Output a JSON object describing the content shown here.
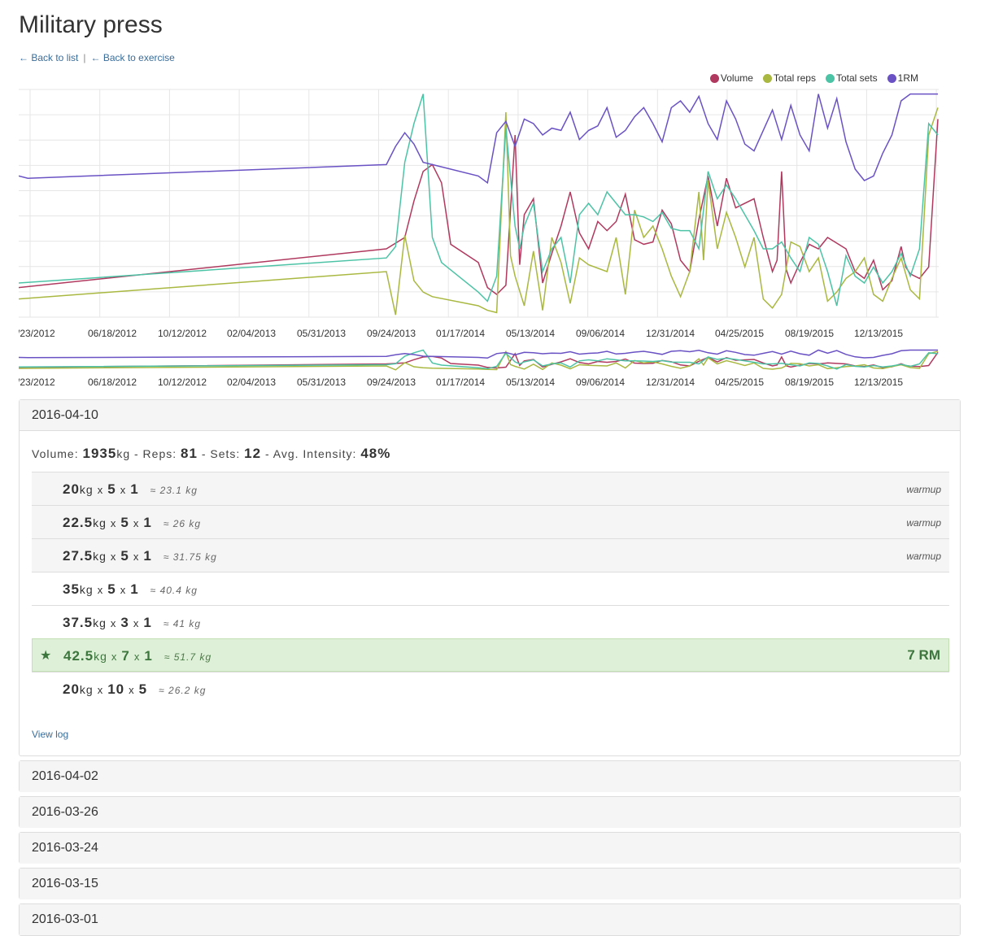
{
  "page": {
    "title": "Military press",
    "back_to_list": "← Back to list",
    "separator": "|",
    "back_to_exercise": "← Back to exercise"
  },
  "colors": {
    "volume": "#b0395f",
    "reps": "#a9b840",
    "sets": "#4dc3a6",
    "rm": "#6a52c4",
    "grid": "#e6e6e6"
  },
  "chart_data": {
    "type": "line",
    "legend_position": "top-right",
    "grid": true,
    "x_ticks": [
      "/23/2012",
      "06/18/2012",
      "10/12/2012",
      "02/04/2013",
      "05/31/2013",
      "09/24/2013",
      "01/17/2014",
      "05/13/2014",
      "09/06/2014",
      "12/31/2014",
      "04/25/2015",
      "08/19/2015",
      "12/13/2015"
    ],
    "series": [
      {
        "name": "Volume",
        "color": "#b0395f",
        "values": [
          [
            0,
            0.13
          ],
          [
            0.4,
            0.3
          ],
          [
            0.42,
            0.35
          ],
          [
            0.43,
            0.51
          ],
          [
            0.44,
            0.64
          ],
          [
            0.45,
            0.67
          ],
          [
            0.46,
            0.59
          ],
          [
            0.47,
            0.32
          ],
          [
            0.5,
            0.24
          ],
          [
            0.51,
            0.13
          ],
          [
            0.52,
            0.1
          ],
          [
            0.53,
            0.14
          ],
          [
            0.54,
            0.8
          ],
          [
            0.545,
            0.23
          ],
          [
            0.55,
            0.45
          ],
          [
            0.56,
            0.52
          ],
          [
            0.57,
            0.15
          ],
          [
            0.58,
            0.28
          ],
          [
            0.59,
            0.4
          ],
          [
            0.6,
            0.55
          ],
          [
            0.61,
            0.37
          ],
          [
            0.62,
            0.3
          ],
          [
            0.63,
            0.42
          ],
          [
            0.64,
            0.38
          ],
          [
            0.65,
            0.42
          ],
          [
            0.66,
            0.54
          ],
          [
            0.67,
            0.34
          ],
          [
            0.68,
            0.32
          ],
          [
            0.69,
            0.33
          ],
          [
            0.7,
            0.47
          ],
          [
            0.71,
            0.41
          ],
          [
            0.72,
            0.25
          ],
          [
            0.73,
            0.2
          ],
          [
            0.74,
            0.43
          ],
          [
            0.75,
            0.62
          ],
          [
            0.76,
            0.4
          ],
          [
            0.77,
            0.61
          ],
          [
            0.78,
            0.48
          ],
          [
            0.8,
            0.52
          ],
          [
            0.81,
            0.35
          ],
          [
            0.82,
            0.2
          ],
          [
            0.825,
            0.25
          ],
          [
            0.83,
            0.64
          ],
          [
            0.835,
            0.21
          ],
          [
            0.84,
            0.15
          ],
          [
            0.85,
            0.24
          ],
          [
            0.86,
            0.32
          ],
          [
            0.87,
            0.3
          ],
          [
            0.88,
            0.35
          ],
          [
            0.9,
            0.3
          ],
          [
            0.91,
            0.2
          ],
          [
            0.92,
            0.17
          ],
          [
            0.93,
            0.25
          ],
          [
            0.94,
            0.12
          ],
          [
            0.95,
            0.16
          ],
          [
            0.96,
            0.31
          ],
          [
            0.965,
            0.22
          ],
          [
            0.97,
            0.19
          ],
          [
            0.98,
            0.17
          ],
          [
            0.99,
            0.22
          ],
          [
            1,
            0.87
          ]
        ]
      },
      {
        "name": "Total reps",
        "color": "#a9b840",
        "values": [
          [
            0,
            0.08
          ],
          [
            0.4,
            0.2
          ],
          [
            0.41,
            0.01
          ],
          [
            0.42,
            0.36
          ],
          [
            0.43,
            0.16
          ],
          [
            0.44,
            0.11
          ],
          [
            0.45,
            0.09
          ],
          [
            0.5,
            0.05
          ],
          [
            0.51,
            0.03
          ],
          [
            0.52,
            0.02
          ],
          [
            0.53,
            0.9
          ],
          [
            0.535,
            0.27
          ],
          [
            0.54,
            0.18
          ],
          [
            0.55,
            0.05
          ],
          [
            0.56,
            0.29
          ],
          [
            0.57,
            0.03
          ],
          [
            0.58,
            0.35
          ],
          [
            0.59,
            0.24
          ],
          [
            0.6,
            0.06
          ],
          [
            0.61,
            0.26
          ],
          [
            0.62,
            0.23
          ],
          [
            0.64,
            0.2
          ],
          [
            0.65,
            0.35
          ],
          [
            0.66,
            0.1
          ],
          [
            0.67,
            0.47
          ],
          [
            0.68,
            0.35
          ],
          [
            0.69,
            0.4
          ],
          [
            0.7,
            0.3
          ],
          [
            0.71,
            0.18
          ],
          [
            0.72,
            0.09
          ],
          [
            0.73,
            0.2
          ],
          [
            0.74,
            0.55
          ],
          [
            0.745,
            0.25
          ],
          [
            0.75,
            0.6
          ],
          [
            0.76,
            0.3
          ],
          [
            0.77,
            0.46
          ],
          [
            0.78,
            0.35
          ],
          [
            0.79,
            0.22
          ],
          [
            0.8,
            0.35
          ],
          [
            0.81,
            0.08
          ],
          [
            0.82,
            0.04
          ],
          [
            0.83,
            0.1
          ],
          [
            0.84,
            0.33
          ],
          [
            0.85,
            0.31
          ],
          [
            0.86,
            0.2
          ],
          [
            0.87,
            0.26
          ],
          [
            0.88,
            0.07
          ],
          [
            0.89,
            0.11
          ],
          [
            0.9,
            0.17
          ],
          [
            0.91,
            0.2
          ],
          [
            0.92,
            0.26
          ],
          [
            0.93,
            0.1
          ],
          [
            0.94,
            0.07
          ],
          [
            0.95,
            0.17
          ],
          [
            0.96,
            0.26
          ],
          [
            0.97,
            0.12
          ],
          [
            0.98,
            0.08
          ],
          [
            0.99,
            0.8
          ],
          [
            1,
            0.92
          ]
        ]
      },
      {
        "name": "Total sets",
        "color": "#4dc3a6",
        "values": [
          [
            0,
            0.15
          ],
          [
            0.4,
            0.26
          ],
          [
            0.41,
            0.31
          ],
          [
            0.42,
            0.68
          ],
          [
            0.43,
            0.85
          ],
          [
            0.44,
            0.98
          ],
          [
            0.45,
            0.35
          ],
          [
            0.46,
            0.24
          ],
          [
            0.5,
            0.11
          ],
          [
            0.51,
            0.07
          ],
          [
            0.52,
            0.18
          ],
          [
            0.53,
            0.83
          ],
          [
            0.54,
            0.4
          ],
          [
            0.545,
            0.3
          ],
          [
            0.55,
            0.4
          ],
          [
            0.56,
            0.5
          ],
          [
            0.57,
            0.2
          ],
          [
            0.58,
            0.3
          ],
          [
            0.59,
            0.35
          ],
          [
            0.6,
            0.15
          ],
          [
            0.61,
            0.45
          ],
          [
            0.62,
            0.5
          ],
          [
            0.63,
            0.45
          ],
          [
            0.64,
            0.55
          ],
          [
            0.65,
            0.5
          ],
          [
            0.66,
            0.45
          ],
          [
            0.67,
            0.45
          ],
          [
            0.68,
            0.44
          ],
          [
            0.69,
            0.42
          ],
          [
            0.7,
            0.46
          ],
          [
            0.71,
            0.39
          ],
          [
            0.72,
            0.38
          ],
          [
            0.73,
            0.38
          ],
          [
            0.74,
            0.3
          ],
          [
            0.75,
            0.64
          ],
          [
            0.76,
            0.52
          ],
          [
            0.77,
            0.58
          ],
          [
            0.78,
            0.52
          ],
          [
            0.8,
            0.38
          ],
          [
            0.81,
            0.3
          ],
          [
            0.82,
            0.3
          ],
          [
            0.83,
            0.33
          ],
          [
            0.84,
            0.26
          ],
          [
            0.85,
            0.2
          ],
          [
            0.86,
            0.35
          ],
          [
            0.87,
            0.32
          ],
          [
            0.88,
            0.2
          ],
          [
            0.89,
            0.05
          ],
          [
            0.9,
            0.27
          ],
          [
            0.91,
            0.18
          ],
          [
            0.92,
            0.15
          ],
          [
            0.93,
            0.22
          ],
          [
            0.94,
            0.15
          ],
          [
            0.95,
            0.2
          ],
          [
            0.96,
            0.28
          ],
          [
            0.97,
            0.18
          ],
          [
            0.98,
            0.3
          ],
          [
            0.99,
            0.85
          ],
          [
            1,
            0.8
          ]
        ]
      },
      {
        "name": "1RM",
        "color": "#6a52c4",
        "values": [
          [
            0,
            0.62
          ],
          [
            0.01,
            0.61
          ],
          [
            0.4,
            0.67
          ],
          [
            0.41,
            0.75
          ],
          [
            0.42,
            0.81
          ],
          [
            0.43,
            0.76
          ],
          [
            0.44,
            0.68
          ],
          [
            0.45,
            0.67
          ],
          [
            0.5,
            0.62
          ],
          [
            0.51,
            0.59
          ],
          [
            0.52,
            0.81
          ],
          [
            0.53,
            0.86
          ],
          [
            0.54,
            0.75
          ],
          [
            0.55,
            0.87
          ],
          [
            0.56,
            0.85
          ],
          [
            0.57,
            0.8
          ],
          [
            0.58,
            0.83
          ],
          [
            0.59,
            0.82
          ],
          [
            0.6,
            0.9
          ],
          [
            0.61,
            0.78
          ],
          [
            0.62,
            0.82
          ],
          [
            0.63,
            0.84
          ],
          [
            0.64,
            0.92
          ],
          [
            0.65,
            0.79
          ],
          [
            0.66,
            0.82
          ],
          [
            0.67,
            0.88
          ],
          [
            0.68,
            0.92
          ],
          [
            0.69,
            0.85
          ],
          [
            0.7,
            0.77
          ],
          [
            0.71,
            0.92
          ],
          [
            0.72,
            0.95
          ],
          [
            0.73,
            0.9
          ],
          [
            0.74,
            0.97
          ],
          [
            0.75,
            0.85
          ],
          [
            0.76,
            0.78
          ],
          [
            0.77,
            0.95
          ],
          [
            0.78,
            0.87
          ],
          [
            0.79,
            0.76
          ],
          [
            0.8,
            0.73
          ],
          [
            0.81,
            0.82
          ],
          [
            0.82,
            0.91
          ],
          [
            0.83,
            0.78
          ],
          [
            0.84,
            0.93
          ],
          [
            0.85,
            0.8
          ],
          [
            0.86,
            0.73
          ],
          [
            0.87,
            0.98
          ],
          [
            0.88,
            0.83
          ],
          [
            0.89,
            0.96
          ],
          [
            0.9,
            0.77
          ],
          [
            0.91,
            0.65
          ],
          [
            0.92,
            0.6
          ],
          [
            0.93,
            0.62
          ],
          [
            0.94,
            0.72
          ],
          [
            0.95,
            0.8
          ],
          [
            0.96,
            0.95
          ],
          [
            0.97,
            0.98
          ],
          [
            1,
            0.98
          ]
        ]
      }
    ]
  },
  "open_entry": {
    "date": "2016-04-10",
    "summary": {
      "volume_label": "Volume: ",
      "volume": "1935",
      "volume_unit": "kg",
      "reps_label": " - Reps: ",
      "reps": "81",
      "sets_label": " - Sets: ",
      "sets": "12",
      "intensity_label": " - Avg. Intensity: ",
      "intensity": "48%"
    },
    "sets": [
      {
        "weight": "20",
        "reps": "5",
        "sets": "1",
        "est": "≈ 23.1 kg",
        "tag": "warmup"
      },
      {
        "weight": "22.5",
        "reps": "5",
        "sets": "1",
        "est": "≈ 26 kg",
        "tag": "warmup"
      },
      {
        "weight": "27.5",
        "reps": "5",
        "sets": "1",
        "est": "≈ 31.75 kg",
        "tag": "warmup"
      },
      {
        "weight": "35",
        "reps": "5",
        "sets": "1",
        "est": "≈ 40.4 kg",
        "tag": ""
      },
      {
        "weight": "37.5",
        "reps": "3",
        "sets": "1",
        "est": "≈ 41 kg",
        "tag": ""
      },
      {
        "weight": "42.5",
        "reps": "7",
        "sets": "1",
        "est": "≈ 51.7 kg",
        "tag": "",
        "pr": "7 RM"
      },
      {
        "weight": "20",
        "reps": "10",
        "sets": "5",
        "est": "≈ 26.2 kg",
        "tag": ""
      }
    ],
    "unit": "kg",
    "times": "x",
    "star": "★",
    "view_log": "View log"
  },
  "collapsed_entries": [
    "2016-04-02",
    "2016-03-26",
    "2016-03-24",
    "2016-03-15",
    "2016-03-01"
  ]
}
